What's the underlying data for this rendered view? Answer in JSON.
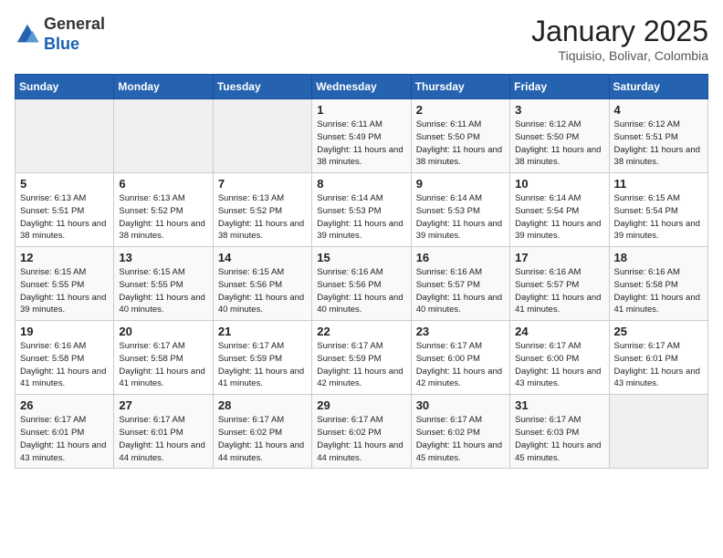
{
  "header": {
    "logo_general": "General",
    "logo_blue": "Blue",
    "title": "January 2025",
    "subtitle": "Tiquisio, Bolivar, Colombia"
  },
  "days_of_week": [
    "Sunday",
    "Monday",
    "Tuesday",
    "Wednesday",
    "Thursday",
    "Friday",
    "Saturday"
  ],
  "weeks": [
    [
      {
        "day": "",
        "sunrise": "",
        "sunset": "",
        "daylight": "",
        "empty": true
      },
      {
        "day": "",
        "sunrise": "",
        "sunset": "",
        "daylight": "",
        "empty": true
      },
      {
        "day": "",
        "sunrise": "",
        "sunset": "",
        "daylight": "",
        "empty": true
      },
      {
        "day": "1",
        "sunrise": "Sunrise: 6:11 AM",
        "sunset": "Sunset: 5:49 PM",
        "daylight": "Daylight: 11 hours and 38 minutes."
      },
      {
        "day": "2",
        "sunrise": "Sunrise: 6:11 AM",
        "sunset": "Sunset: 5:50 PM",
        "daylight": "Daylight: 11 hours and 38 minutes."
      },
      {
        "day": "3",
        "sunrise": "Sunrise: 6:12 AM",
        "sunset": "Sunset: 5:50 PM",
        "daylight": "Daylight: 11 hours and 38 minutes."
      },
      {
        "day": "4",
        "sunrise": "Sunrise: 6:12 AM",
        "sunset": "Sunset: 5:51 PM",
        "daylight": "Daylight: 11 hours and 38 minutes."
      }
    ],
    [
      {
        "day": "5",
        "sunrise": "Sunrise: 6:13 AM",
        "sunset": "Sunset: 5:51 PM",
        "daylight": "Daylight: 11 hours and 38 minutes."
      },
      {
        "day": "6",
        "sunrise": "Sunrise: 6:13 AM",
        "sunset": "Sunset: 5:52 PM",
        "daylight": "Daylight: 11 hours and 38 minutes."
      },
      {
        "day": "7",
        "sunrise": "Sunrise: 6:13 AM",
        "sunset": "Sunset: 5:52 PM",
        "daylight": "Daylight: 11 hours and 38 minutes."
      },
      {
        "day": "8",
        "sunrise": "Sunrise: 6:14 AM",
        "sunset": "Sunset: 5:53 PM",
        "daylight": "Daylight: 11 hours and 39 minutes."
      },
      {
        "day": "9",
        "sunrise": "Sunrise: 6:14 AM",
        "sunset": "Sunset: 5:53 PM",
        "daylight": "Daylight: 11 hours and 39 minutes."
      },
      {
        "day": "10",
        "sunrise": "Sunrise: 6:14 AM",
        "sunset": "Sunset: 5:54 PM",
        "daylight": "Daylight: 11 hours and 39 minutes."
      },
      {
        "day": "11",
        "sunrise": "Sunrise: 6:15 AM",
        "sunset": "Sunset: 5:54 PM",
        "daylight": "Daylight: 11 hours and 39 minutes."
      }
    ],
    [
      {
        "day": "12",
        "sunrise": "Sunrise: 6:15 AM",
        "sunset": "Sunset: 5:55 PM",
        "daylight": "Daylight: 11 hours and 39 minutes."
      },
      {
        "day": "13",
        "sunrise": "Sunrise: 6:15 AM",
        "sunset": "Sunset: 5:55 PM",
        "daylight": "Daylight: 11 hours and 40 minutes."
      },
      {
        "day": "14",
        "sunrise": "Sunrise: 6:15 AM",
        "sunset": "Sunset: 5:56 PM",
        "daylight": "Daylight: 11 hours and 40 minutes."
      },
      {
        "day": "15",
        "sunrise": "Sunrise: 6:16 AM",
        "sunset": "Sunset: 5:56 PM",
        "daylight": "Daylight: 11 hours and 40 minutes."
      },
      {
        "day": "16",
        "sunrise": "Sunrise: 6:16 AM",
        "sunset": "Sunset: 5:57 PM",
        "daylight": "Daylight: 11 hours and 40 minutes."
      },
      {
        "day": "17",
        "sunrise": "Sunrise: 6:16 AM",
        "sunset": "Sunset: 5:57 PM",
        "daylight": "Daylight: 11 hours and 41 minutes."
      },
      {
        "day": "18",
        "sunrise": "Sunrise: 6:16 AM",
        "sunset": "Sunset: 5:58 PM",
        "daylight": "Daylight: 11 hours and 41 minutes."
      }
    ],
    [
      {
        "day": "19",
        "sunrise": "Sunrise: 6:16 AM",
        "sunset": "Sunset: 5:58 PM",
        "daylight": "Daylight: 11 hours and 41 minutes."
      },
      {
        "day": "20",
        "sunrise": "Sunrise: 6:17 AM",
        "sunset": "Sunset: 5:58 PM",
        "daylight": "Daylight: 11 hours and 41 minutes."
      },
      {
        "day": "21",
        "sunrise": "Sunrise: 6:17 AM",
        "sunset": "Sunset: 5:59 PM",
        "daylight": "Daylight: 11 hours and 41 minutes."
      },
      {
        "day": "22",
        "sunrise": "Sunrise: 6:17 AM",
        "sunset": "Sunset: 5:59 PM",
        "daylight": "Daylight: 11 hours and 42 minutes."
      },
      {
        "day": "23",
        "sunrise": "Sunrise: 6:17 AM",
        "sunset": "Sunset: 6:00 PM",
        "daylight": "Daylight: 11 hours and 42 minutes."
      },
      {
        "day": "24",
        "sunrise": "Sunrise: 6:17 AM",
        "sunset": "Sunset: 6:00 PM",
        "daylight": "Daylight: 11 hours and 43 minutes."
      },
      {
        "day": "25",
        "sunrise": "Sunrise: 6:17 AM",
        "sunset": "Sunset: 6:01 PM",
        "daylight": "Daylight: 11 hours and 43 minutes."
      }
    ],
    [
      {
        "day": "26",
        "sunrise": "Sunrise: 6:17 AM",
        "sunset": "Sunset: 6:01 PM",
        "daylight": "Daylight: 11 hours and 43 minutes."
      },
      {
        "day": "27",
        "sunrise": "Sunrise: 6:17 AM",
        "sunset": "Sunset: 6:01 PM",
        "daylight": "Daylight: 11 hours and 44 minutes."
      },
      {
        "day": "28",
        "sunrise": "Sunrise: 6:17 AM",
        "sunset": "Sunset: 6:02 PM",
        "daylight": "Daylight: 11 hours and 44 minutes."
      },
      {
        "day": "29",
        "sunrise": "Sunrise: 6:17 AM",
        "sunset": "Sunset: 6:02 PM",
        "daylight": "Daylight: 11 hours and 44 minutes."
      },
      {
        "day": "30",
        "sunrise": "Sunrise: 6:17 AM",
        "sunset": "Sunset: 6:02 PM",
        "daylight": "Daylight: 11 hours and 45 minutes."
      },
      {
        "day": "31",
        "sunrise": "Sunrise: 6:17 AM",
        "sunset": "Sunset: 6:03 PM",
        "daylight": "Daylight: 11 hours and 45 minutes."
      },
      {
        "day": "",
        "sunrise": "",
        "sunset": "",
        "daylight": "",
        "empty": true
      }
    ]
  ]
}
